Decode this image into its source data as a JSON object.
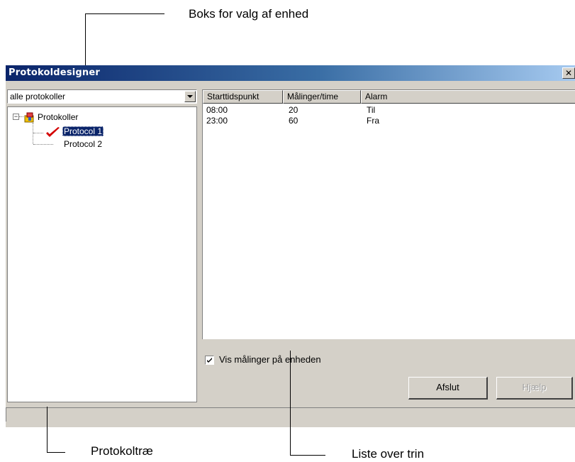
{
  "annotations": {
    "unit_selector": "Boks for valg af enhed",
    "protocol_tree": "Protokoltræ",
    "step_list": "Liste over trin"
  },
  "window": {
    "title": "Protokoldesigner",
    "close_glyph": "✕"
  },
  "unit_combo": {
    "selected": "alle protokoller"
  },
  "tree": {
    "root": "Protokoller",
    "items": [
      {
        "label": "Protocol 1",
        "selected": true,
        "active": true
      },
      {
        "label": "Protocol 2",
        "selected": false,
        "active": false
      }
    ],
    "icons": {
      "root": "folder-tree-icon",
      "active": "red-check-icon"
    }
  },
  "steps_table": {
    "columns": [
      "Starttidspunkt",
      "Målinger/time",
      "Alarm"
    ],
    "rows": [
      [
        "08:00",
        "20",
        "Til"
      ],
      [
        "23:00",
        "60",
        "Fra"
      ]
    ]
  },
  "show_on_unit": {
    "label": "Vis målinger på enheden",
    "checked": true
  },
  "buttons": {
    "close": "Afslut",
    "help": "Hjælp"
  },
  "colors": {
    "titlebar_start": "#0a246a",
    "titlebar_end": "#a6caf0",
    "selection": "#0a246a",
    "check": "#d40000",
    "face": "#d4d0c8"
  }
}
